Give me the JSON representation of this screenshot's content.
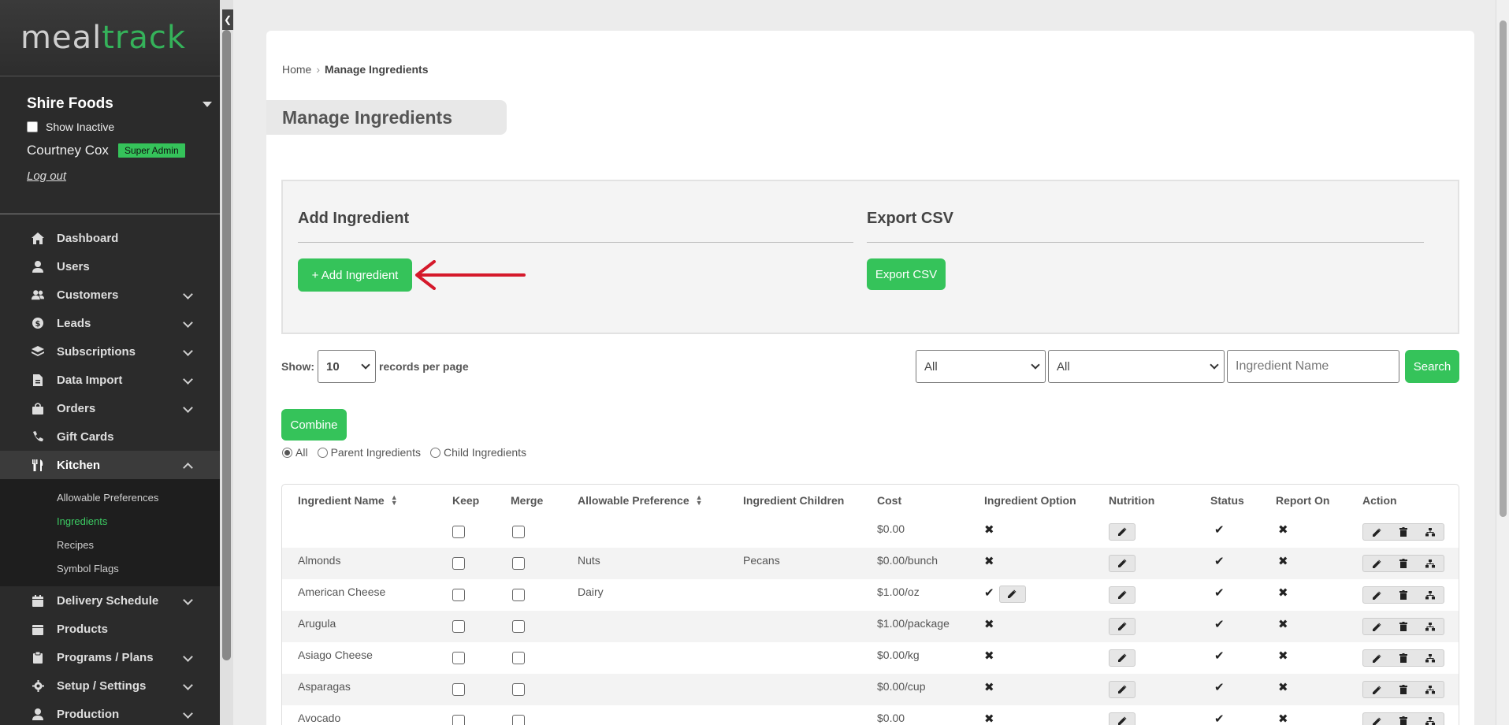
{
  "sidebar": {
    "logo_meal": "meal",
    "logo_track": "track",
    "company": "Shire Foods",
    "show_inactive": "Show Inactive",
    "user_name": "Courtney Cox",
    "role_badge": "Super Admin",
    "logout": "Log out",
    "nav": [
      {
        "label": "Dashboard",
        "icon": "home-icon"
      },
      {
        "label": "Users",
        "icon": "user-icon"
      },
      {
        "label": "Customers",
        "icon": "users-icon"
      },
      {
        "label": "Leads",
        "icon": "dollar-icon"
      },
      {
        "label": "Subscriptions",
        "icon": "layers-icon"
      },
      {
        "label": "Data Import",
        "icon": "file-icon"
      },
      {
        "label": "Orders",
        "icon": "bag-icon"
      },
      {
        "label": "Gift Cards",
        "icon": "phone-icon"
      },
      {
        "label": "Kitchen",
        "icon": "utensils-icon"
      },
      {
        "label": "Delivery Schedule",
        "icon": "calendar-icon"
      },
      {
        "label": "Products",
        "icon": "box-icon"
      },
      {
        "label": "Programs / Plans",
        "icon": "clipboard-icon"
      },
      {
        "label": "Setup / Settings",
        "icon": "gear-icon"
      },
      {
        "label": "Production",
        "icon": "user-icon"
      }
    ],
    "kitchen_sub": [
      "Allowable Preferences",
      "Ingredients",
      "Recipes",
      "Symbol Flags"
    ]
  },
  "breadcrumb": {
    "home": "Home",
    "current": "Manage Ingredients"
  },
  "page_title": "Manage Ingredients",
  "add_panel": {
    "heading": "Add Ingredient",
    "button": "+ Add Ingredient"
  },
  "export_panel": {
    "heading": "Export CSV",
    "button": "Export CSV"
  },
  "controls": {
    "show_label": "Show:",
    "per_page": "10",
    "records_label": "records per page",
    "filter1": "All",
    "filter2": "All",
    "search_placeholder": "Ingredient Name",
    "search_button": "Search",
    "combine_button": "Combine",
    "radios": [
      "All",
      "Parent Ingredients",
      "Child Ingredients"
    ]
  },
  "table": {
    "headers": [
      "Ingredient Name",
      "Keep",
      "Merge",
      "Allowable Preference",
      "Ingredient Children",
      "Cost",
      "Ingredient Option",
      "Nutrition",
      "Status",
      "Report On",
      "Action"
    ],
    "rows": [
      {
        "name": "",
        "pref": "",
        "children": "",
        "cost": "$0.00",
        "option": "✖",
        "status": "✔",
        "report": "✖"
      },
      {
        "name": "Almonds",
        "pref": "Nuts",
        "children": "Pecans",
        "cost": "$0.00/bunch",
        "option": "✖",
        "status": "✔",
        "report": "✖"
      },
      {
        "name": "American Cheese",
        "pref": "Dairy",
        "children": "",
        "cost": "$1.00/oz",
        "option": "✔",
        "status": "✔",
        "report": "✖"
      },
      {
        "name": "Arugula",
        "pref": "",
        "children": "",
        "cost": "$1.00/package",
        "option": "✖",
        "status": "✔",
        "report": "✖"
      },
      {
        "name": "Asiago Cheese",
        "pref": "",
        "children": "",
        "cost": "$0.00/kg",
        "option": "✖",
        "status": "✔",
        "report": "✖"
      },
      {
        "name": "Asparagas",
        "pref": "",
        "children": "",
        "cost": "$0.00/cup",
        "option": "✖",
        "status": "✔",
        "report": "✖"
      },
      {
        "name": "Avocado",
        "pref": "",
        "children": "",
        "cost": "$0.00",
        "option": "✖",
        "status": "✔",
        "report": "✖"
      }
    ]
  },
  "colors": {
    "accent": "#35c35a",
    "sidebar": "#2b2b2b",
    "arrow": "#d5192b"
  }
}
